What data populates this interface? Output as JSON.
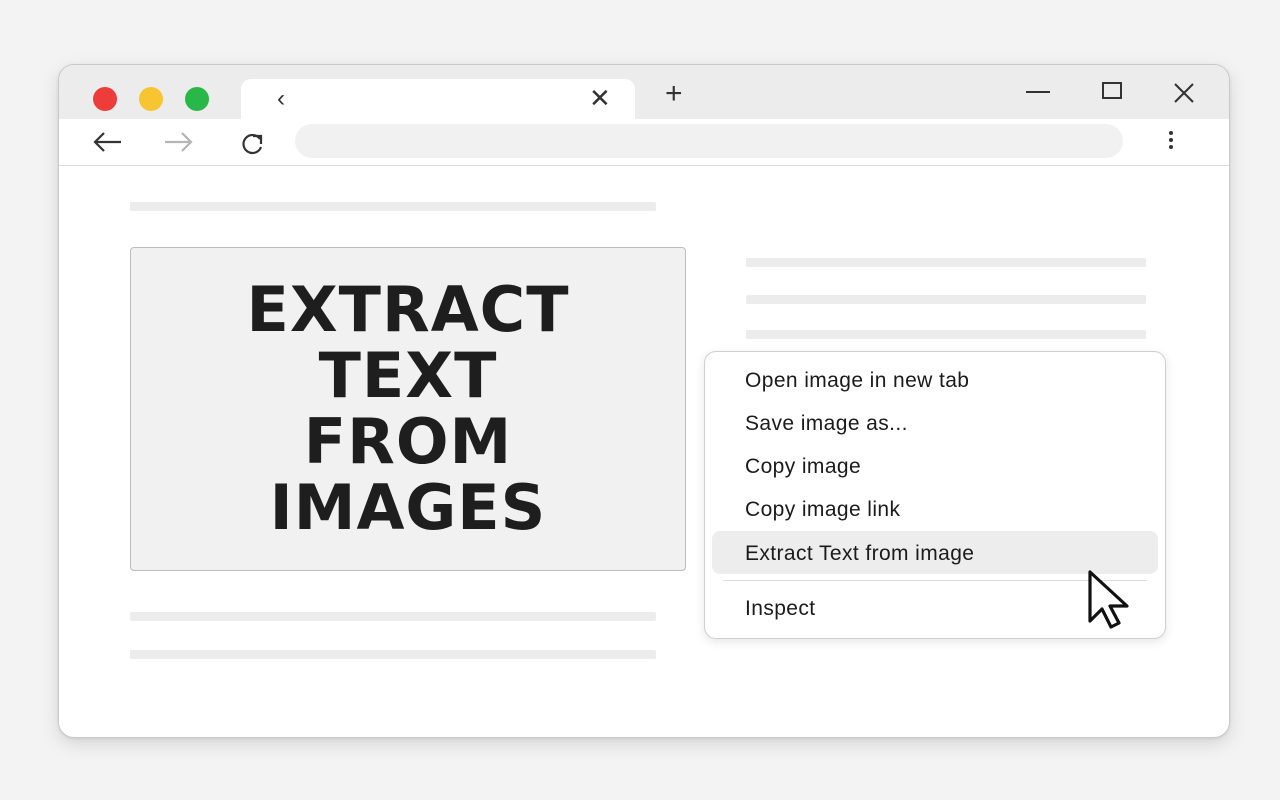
{
  "browser": {
    "traffic_lights": [
      {
        "name": "close",
        "color": "#ec3d3a"
      },
      {
        "name": "minimize",
        "color": "#f6c531"
      },
      {
        "name": "maximize",
        "color": "#2ab74a"
      }
    ],
    "tab": {
      "back_glyph": "‹",
      "close_glyph": "✕"
    },
    "new_tab_glyph": "+",
    "window_controls": [
      "minimize-icon",
      "maximize-icon",
      "close-icon"
    ],
    "toolbar": {
      "icons": [
        "back-arrow-icon",
        "forward-arrow-icon",
        "reload-icon",
        "more-menu-icon"
      ],
      "address_value": ""
    }
  },
  "page": {
    "image_text_lines": [
      "EXTRACT",
      "TEXT",
      "FROM",
      "IMAGES"
    ]
  },
  "context_menu": {
    "items": [
      {
        "label": "Open image in new tab"
      },
      {
        "label": "Save image as..."
      },
      {
        "label": "Copy image"
      },
      {
        "label": "Copy image link"
      },
      {
        "label": "Extract Text from image",
        "highlighted": true
      },
      {
        "label": "Inspect"
      }
    ]
  },
  "colors": {
    "window_bg": "#ffffff",
    "tabstrip_bg": "#ececec",
    "placeholder_bar": "#ececec",
    "menu_highlight": "#ededed"
  }
}
